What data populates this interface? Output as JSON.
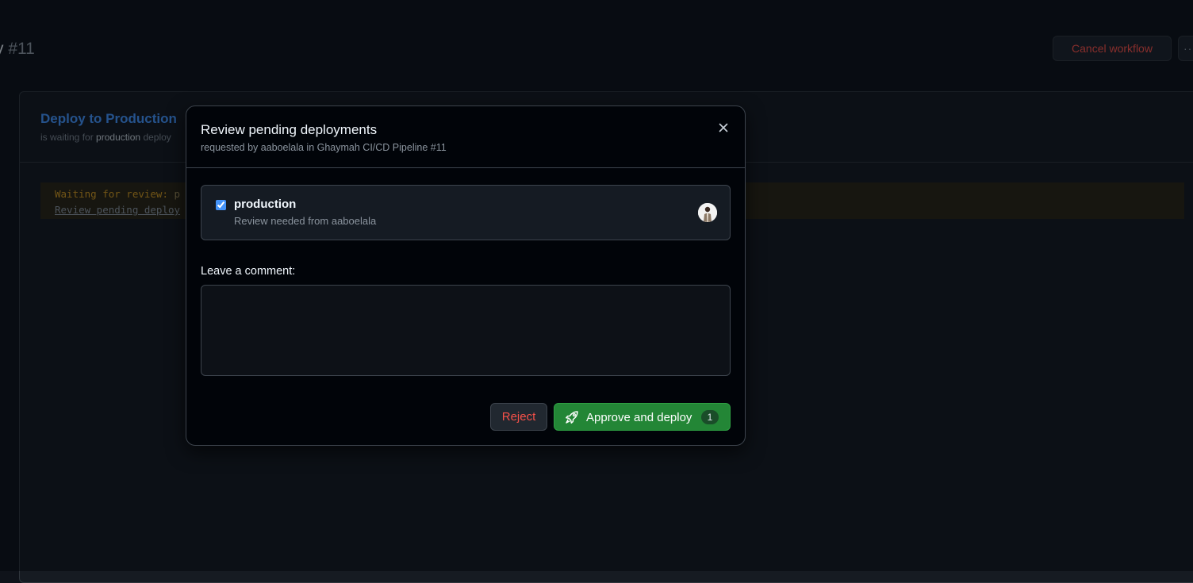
{
  "page": {
    "title_fragment": "y",
    "run_number": "#11",
    "cancel_label": "Cancel workflow",
    "more_label": "··"
  },
  "job": {
    "title": "Deploy to Production",
    "sub_prefix": "is waiting for",
    "environment": "production",
    "sub_suffix": "deploy"
  },
  "log": {
    "line1_label": "Waiting for review:",
    "line1_rest": "p",
    "line2_link": "Review pending deploy"
  },
  "dialog": {
    "title": "Review pending deployments",
    "subtitle": "requested by aaboelala in Ghaymah CI/CD Pipeline #11",
    "environment": {
      "name": "production",
      "description": "Review needed from aaboelala",
      "checked": true
    },
    "comment_label": "Leave a comment:",
    "comment_value": "",
    "reject_label": "Reject",
    "approve_label": "Approve and deploy",
    "approve_count": "1"
  },
  "icons": {
    "close": "close-icon",
    "rocket": "rocket-icon",
    "avatar": "avatar"
  },
  "colors": {
    "accent_blue": "#4493f8",
    "danger": "#f85149",
    "success": "#238636",
    "warning": "#d29922"
  }
}
